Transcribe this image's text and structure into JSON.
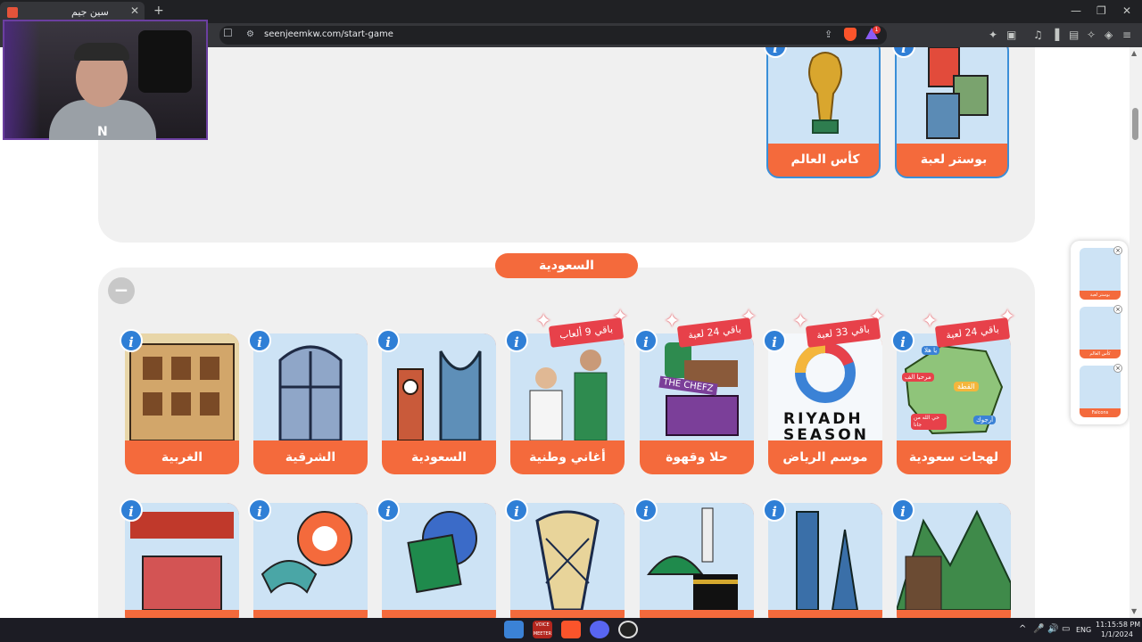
{
  "browser": {
    "tab_title": "سين جيم",
    "tab_close": "✕",
    "new_tab": "+",
    "url": "seenjeemkw.com/start-game",
    "rewards_badge": "1",
    "window_controls": [
      "—",
      "❐",
      "✕"
    ]
  },
  "webcam": {
    "logo": "N"
  },
  "top_section": {
    "cards": [
      {
        "label": "كأس العالم",
        "icon": "world-cup-trophy"
      },
      {
        "label": "بوستر لعبة",
        "icon": "game-posters"
      }
    ]
  },
  "saudi_section": {
    "title": "السعودية",
    "collapse_label": "−",
    "info_glyph": "i",
    "row1": [
      {
        "label": "الغربية",
        "ribbon": ""
      },
      {
        "label": "الشرقية",
        "ribbon": ""
      },
      {
        "label": "السعودية",
        "ribbon": ""
      },
      {
        "label": "أغاني وطنية",
        "ribbon": "باقي 9 ألعاب"
      },
      {
        "label": "حلا وقهوة",
        "ribbon": "باقي 24 لعبة"
      },
      {
        "label": "موسم الرياض",
        "ribbon": "باقي 33 لعبة"
      },
      {
        "label": "لهجات سعودية",
        "ribbon": "باقي 24 لعبة"
      }
    ],
    "row2_icons": [
      "market-basket-icon",
      "ring-buoy-icon",
      "palm-emblem-icon",
      "tower-icon",
      "mosque-kaaba-icon",
      "riyadh-skyline-icon",
      "mountain-village-icon"
    ],
    "art_text": {
      "riyadh_season_line1": "RIYADH",
      "riyadh_season_line2": "SEASON",
      "chefz": "THE CHEFZ",
      "dialect_bubbles": [
        "يا هلا",
        "القطة",
        "أرجوك",
        "مرحبا الف",
        "حي الله من جانا"
      ]
    }
  },
  "mini_panel": {
    "items": [
      {
        "label": "بوستر لعبة"
      },
      {
        "label": "كأس العالم"
      },
      {
        "label": "Falcons"
      }
    ],
    "remove_glyph": "×"
  },
  "taskbar": {
    "time": "11:15:58 PM",
    "date": "1/1/2024",
    "lang": "ENG",
    "voicemeeter": "VOICE MEETER"
  },
  "colors": {
    "accent": "#f46a3c",
    "info_blue": "#2f7fd6",
    "ribbon_red": "#e7414a",
    "section_bg": "#f0f0f0"
  }
}
